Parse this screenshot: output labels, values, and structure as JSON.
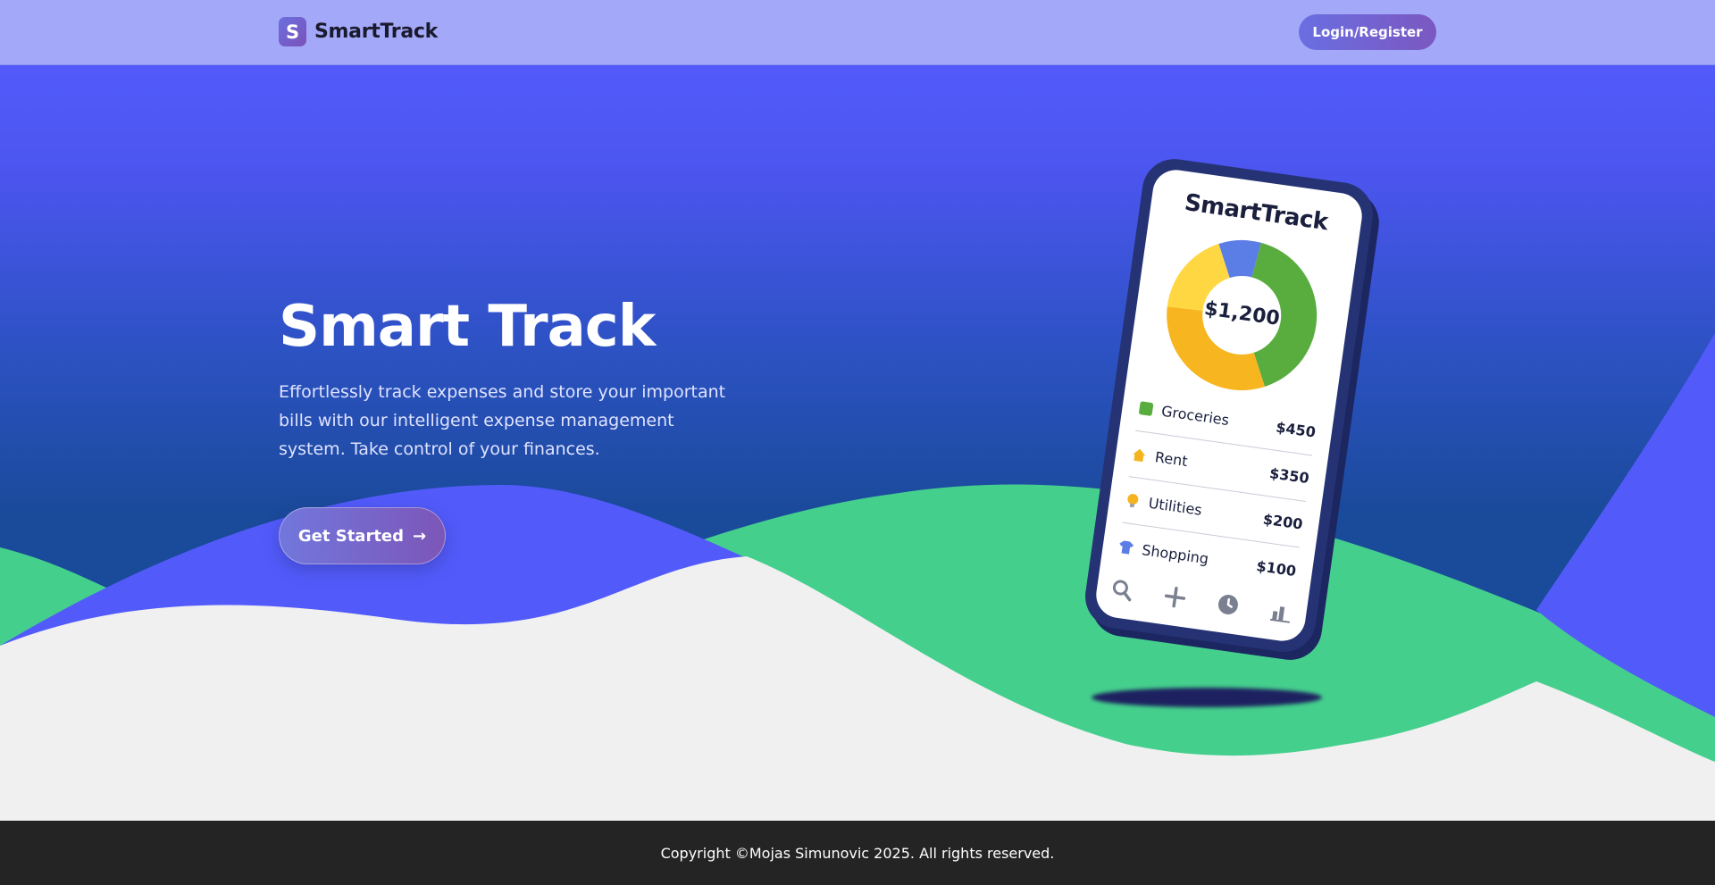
{
  "header": {
    "logo_letter": "S",
    "brand": "SmartTrack",
    "login_label": "Login/Register"
  },
  "hero": {
    "title": "Smart Track",
    "description": "Effortlessly track expenses and store your important bills with our intelligent expense management system. Take control of your finances.",
    "cta_label": "Get Started",
    "cta_arrow": "→"
  },
  "phone": {
    "app_title": "SmartTrack",
    "total": "$1,200",
    "expenses": [
      {
        "name": "Groceries",
        "amount": "$450",
        "value": 450,
        "icon": "square-icon",
        "color": "#58ad3e"
      },
      {
        "name": "Rent",
        "amount": "$350",
        "value": 350,
        "icon": "house-icon",
        "color": "#f5b41f"
      },
      {
        "name": "Utilities",
        "amount": "$200",
        "value": 200,
        "icon": "lightbulb-icon",
        "color": "#f5b41f"
      },
      {
        "name": "Shopping",
        "amount": "$100",
        "value": 100,
        "icon": "shirt-icon",
        "color": "#5b7de6"
      }
    ],
    "donut_colors": [
      "#58ad3e",
      "#f7b51f",
      "#ffd743",
      "#5b7de6"
    ],
    "nav_icons": [
      "search-icon",
      "plus-icon",
      "clock-icon",
      "bar-chart-icon"
    ]
  },
  "colors": {
    "header_bg": "#a4a8f8",
    "hero_blue": "#525bfa",
    "hero_dark": "#1a4a9a",
    "green": "#45cf8d",
    "footer_bg": "#242424"
  },
  "footer": {
    "copyright": "Copyright ©Mojas Simunovic 2025. All rights reserved."
  }
}
